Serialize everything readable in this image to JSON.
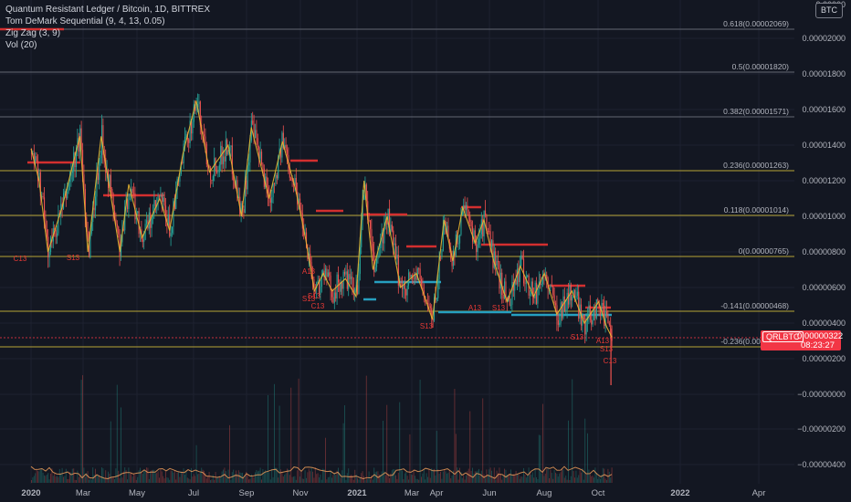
{
  "legend": {
    "title": "Quantum Resistant Ledger / Bitcoin, 1D, BITTREX",
    "indicator_1": "Tom DeMark Sequential (9, 4, 13, 0.05)",
    "indicator_2": "Zig Zag (3, 9)",
    "indicator_3": "Vol (20)"
  },
  "currency_button": "BTC",
  "price_tag": {
    "symbol": "QRLBTC",
    "value": "0.00000322",
    "countdown": "08:23:27"
  },
  "colors": {
    "background": "#131722",
    "up": "#26a69a",
    "down": "#ef5350",
    "fib": "#c9b43a",
    "price_line": "#f23645",
    "support": "#26a0c0",
    "zigzag": "#e8b832"
  },
  "chart_data": {
    "type": "candlestick",
    "symbol": "QRLBTC",
    "exchange": "BITTREX",
    "interval": "1D",
    "x_tick_labels": [
      "2020",
      "Mar",
      "May",
      "Jul",
      "Sep",
      "Nov",
      "2021",
      "Mar",
      "Apr",
      "Jun",
      "Aug",
      "Oct",
      "2022",
      "Apr"
    ],
    "y_tick_labels": [
      "0.00000",
      "0.00002000",
      "0.00001800",
      "0.00001600",
      "0.00001400",
      "0.00001200",
      "0.00001000",
      "0.00000800",
      "0.00000600",
      "0.00000400",
      "0.00000200",
      "−0.00000000",
      "−0.00000200",
      "−0.00000400"
    ],
    "fib_levels": [
      {
        "label": "0.618(0.00002069)",
        "value": 2.069e-05
      },
      {
        "label": "0.5(0.00001820)",
        "value": 1.82e-05
      },
      {
        "label": "0.382(0.00001571)",
        "value": 1.571e-05
      },
      {
        "label": "0.236(0.00001263)",
        "value": 1.263e-05
      },
      {
        "label": "0.118(0.00001014)",
        "value": 1.014e-05
      },
      {
        "label": "0(0.00000765)",
        "value": 7.65e-06
      },
      {
        "label": "-0.141(0.00000468)",
        "value": 4.68e-06
      },
      {
        "label": "-0.236(0.00000267)",
        "value": 2.67e-06
      }
    ],
    "last_price": 3.22e-06,
    "tdseq_labels": [
      "C13",
      "S13",
      "S13",
      "A13",
      "S13",
      "C13",
      "S13",
      "A13",
      "S13",
      "S13",
      "A13",
      "S13",
      "C13"
    ],
    "price_path": [
      [
        "2020-01-01",
        1.38e-05
      ],
      [
        "2020-01-10",
        1.2e-05
      ],
      [
        "2020-01-20",
        8e-06
      ],
      [
        "2020-02-05",
        1.05e-05
      ],
      [
        "2020-02-25",
        1.45e-05
      ],
      [
        "2020-03-05",
        8e-06
      ],
      [
        "2020-03-20",
        1.45e-05
      ],
      [
        "2020-04-10",
        8e-06
      ],
      [
        "2020-04-20",
        1.18e-05
      ],
      [
        "2020-05-05",
        8.8e-06
      ],
      [
        "2020-05-25",
        1.1e-05
      ],
      [
        "2020-06-05",
        9.2e-06
      ],
      [
        "2020-06-20",
        1.35e-05
      ],
      [
        "2020-07-05",
        1.65e-05
      ],
      [
        "2020-07-20",
        1.25e-05
      ],
      [
        "2020-08-10",
        1.4e-05
      ],
      [
        "2020-08-25",
        1e-05
      ],
      [
        "2020-09-05",
        1.5e-05
      ],
      [
        "2020-09-25",
        1.1e-05
      ],
      [
        "2020-10-10",
        1.42e-05
      ],
      [
        "2020-10-25",
        1.15e-05
      ],
      [
        "2020-11-05",
        8.8e-06
      ],
      [
        "2020-11-15",
        5.8e-06
      ],
      [
        "2020-11-25",
        6.8e-06
      ],
      [
        "2020-12-05",
        5.8e-06
      ],
      [
        "2020-12-20",
        6.5e-06
      ],
      [
        "2021-01-01",
        5.5e-06
      ],
      [
        "2021-01-10",
        1.2e-05
      ],
      [
        "2021-01-20",
        7e-06
      ],
      [
        "2021-02-05",
        1e-05
      ],
      [
        "2021-02-20",
        6e-06
      ],
      [
        "2021-03-10",
        6.8e-06
      ],
      [
        "2021-03-28",
        4.2e-06
      ],
      [
        "2021-04-10",
        9.8e-06
      ],
      [
        "2021-04-20",
        7.5e-06
      ],
      [
        "2021-05-01",
        1.05e-05
      ],
      [
        "2021-05-15",
        8.5e-06
      ],
      [
        "2021-05-25",
        9.8e-06
      ],
      [
        "2021-06-05",
        7.5e-06
      ],
      [
        "2021-06-20",
        5.2e-06
      ],
      [
        "2021-07-05",
        7.2e-06
      ],
      [
        "2021-07-20",
        5.5e-06
      ],
      [
        "2021-08-01",
        6.8e-06
      ],
      [
        "2021-08-15",
        4.5e-06
      ],
      [
        "2021-09-01",
        5.8e-06
      ],
      [
        "2021-09-15",
        4e-06
      ],
      [
        "2021-10-01",
        5.2e-06
      ],
      [
        "2021-10-10",
        3.8e-06
      ],
      [
        "2021-10-16",
        3.2e-06
      ]
    ],
    "grid": true
  }
}
